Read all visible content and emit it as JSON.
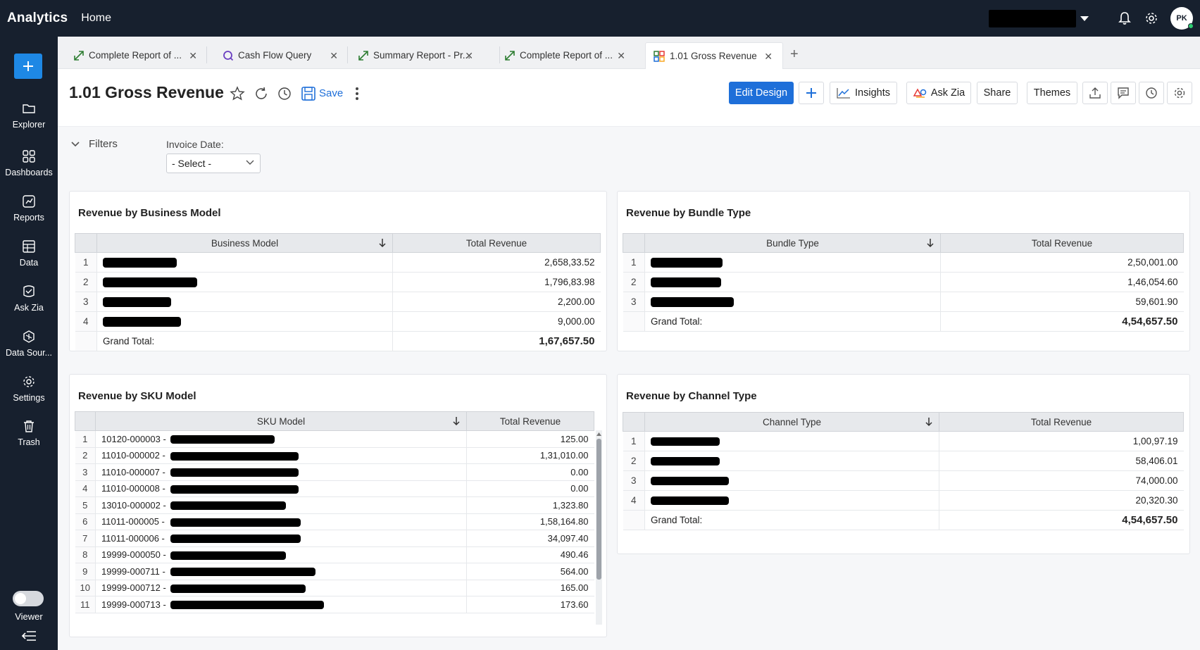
{
  "topbar": {
    "app_name": "Analytics",
    "home_label": "Home",
    "avatar_initials": "PK"
  },
  "sidebar": {
    "items": [
      {
        "label": "Explorer",
        "icon": "folder-icon"
      },
      {
        "label": "Dashboards",
        "icon": "grid-icon"
      },
      {
        "label": "Reports",
        "icon": "report-icon"
      },
      {
        "label": "Data",
        "icon": "table-icon"
      },
      {
        "label": "Ask Zia",
        "icon": "zia-icon"
      },
      {
        "label": "Data Sour...",
        "icon": "datasource-icon"
      },
      {
        "label": "Settings",
        "icon": "gear-icon"
      },
      {
        "label": "Trash",
        "icon": "trash-icon"
      }
    ],
    "viewer_label": "Viewer"
  },
  "tabs": [
    {
      "label": "Complete Report of ...",
      "icon": "expand-icon"
    },
    {
      "label": "Cash Flow Query",
      "icon": "query-icon"
    },
    {
      "label": "Summary Report - Pr...",
      "icon": "expand-icon"
    },
    {
      "label": "Complete Report of ...",
      "icon": "expand-icon"
    },
    {
      "label": "1.01 Gross Revenue",
      "icon": "dashboard-icon",
      "active": true
    }
  ],
  "header": {
    "title": "1.01 Gross Revenue",
    "save_label": "Save",
    "edit_design_label": "Edit Design",
    "insights_label": "Insights",
    "ask_zia_label": "Ask Zia",
    "share_label": "Share",
    "themes_label": "Themes"
  },
  "filters": {
    "label": "Filters",
    "invoice_date_label": "Invoice Date:",
    "invoice_date_value": "- Select -"
  },
  "business_model": {
    "title": "Revenue by Business Model",
    "col1": "Business Model",
    "col2": "Total Revenue",
    "rows": [
      {
        "n": "1",
        "value": "2,658,33.52"
      },
      {
        "n": "2",
        "value": "1,796,83.98"
      },
      {
        "n": "3",
        "value": "2,200.00"
      },
      {
        "n": "4",
        "value": "9,000.00"
      }
    ],
    "total_label": "Grand Total:",
    "total_value": "1,67,657.50"
  },
  "bundle_type": {
    "title": "Revenue by Bundle Type",
    "col1": "Bundle Type",
    "col2": "Total Revenue",
    "rows": [
      {
        "n": "1",
        "value": "2,50,001.00"
      },
      {
        "n": "2",
        "value": "1,46,054.60"
      },
      {
        "n": "3",
        "value": "59,601.90"
      }
    ],
    "total_label": "Grand Total:",
    "total_value": "4,54,657.50"
  },
  "sku_model": {
    "title": "Revenue by SKU Model",
    "col1": "SKU Model",
    "col2": "Total Revenue",
    "rows": [
      {
        "n": "1",
        "code": "10120-000003 -",
        "value": "125.00"
      },
      {
        "n": "2",
        "code": "11010-000002 -",
        "value": "1,31,010.00"
      },
      {
        "n": "3",
        "code": "11010-000007 -",
        "value": "0.00"
      },
      {
        "n": "4",
        "code": "11010-000008 -",
        "value": "0.00"
      },
      {
        "n": "5",
        "code": "13010-000002 -",
        "value": "1,323.80"
      },
      {
        "n": "6",
        "code": "11011-000005 -",
        "value": "1,58,164.80"
      },
      {
        "n": "7",
        "code": "11011-000006 -",
        "value": "34,097.40"
      },
      {
        "n": "8",
        "code": "19999-000050 -",
        "value": "490.46"
      },
      {
        "n": "9",
        "code": "19999-000711 -",
        "value": "564.00"
      },
      {
        "n": "10",
        "code": "19999-000712 -",
        "value": "165.00"
      },
      {
        "n": "11",
        "code": "19999-000713 -",
        "value": "173.60"
      }
    ]
  },
  "channel_type": {
    "title": "Revenue by Channel Type",
    "col1": "Channel Type",
    "col2": "Total Revenue",
    "rows": [
      {
        "n": "1",
        "value": "1,00,97.19"
      },
      {
        "n": "2",
        "value": "58,406.01"
      },
      {
        "n": "3",
        "value": "74,000.00"
      },
      {
        "n": "4",
        "value": "20,320.30"
      }
    ],
    "total_label": "Grand Total:",
    "total_value": "4,54,657.50"
  },
  "colors": {
    "topbar": "#17202e",
    "accent": "#1e6fd9",
    "content_bg": "#f6f7f9"
  }
}
